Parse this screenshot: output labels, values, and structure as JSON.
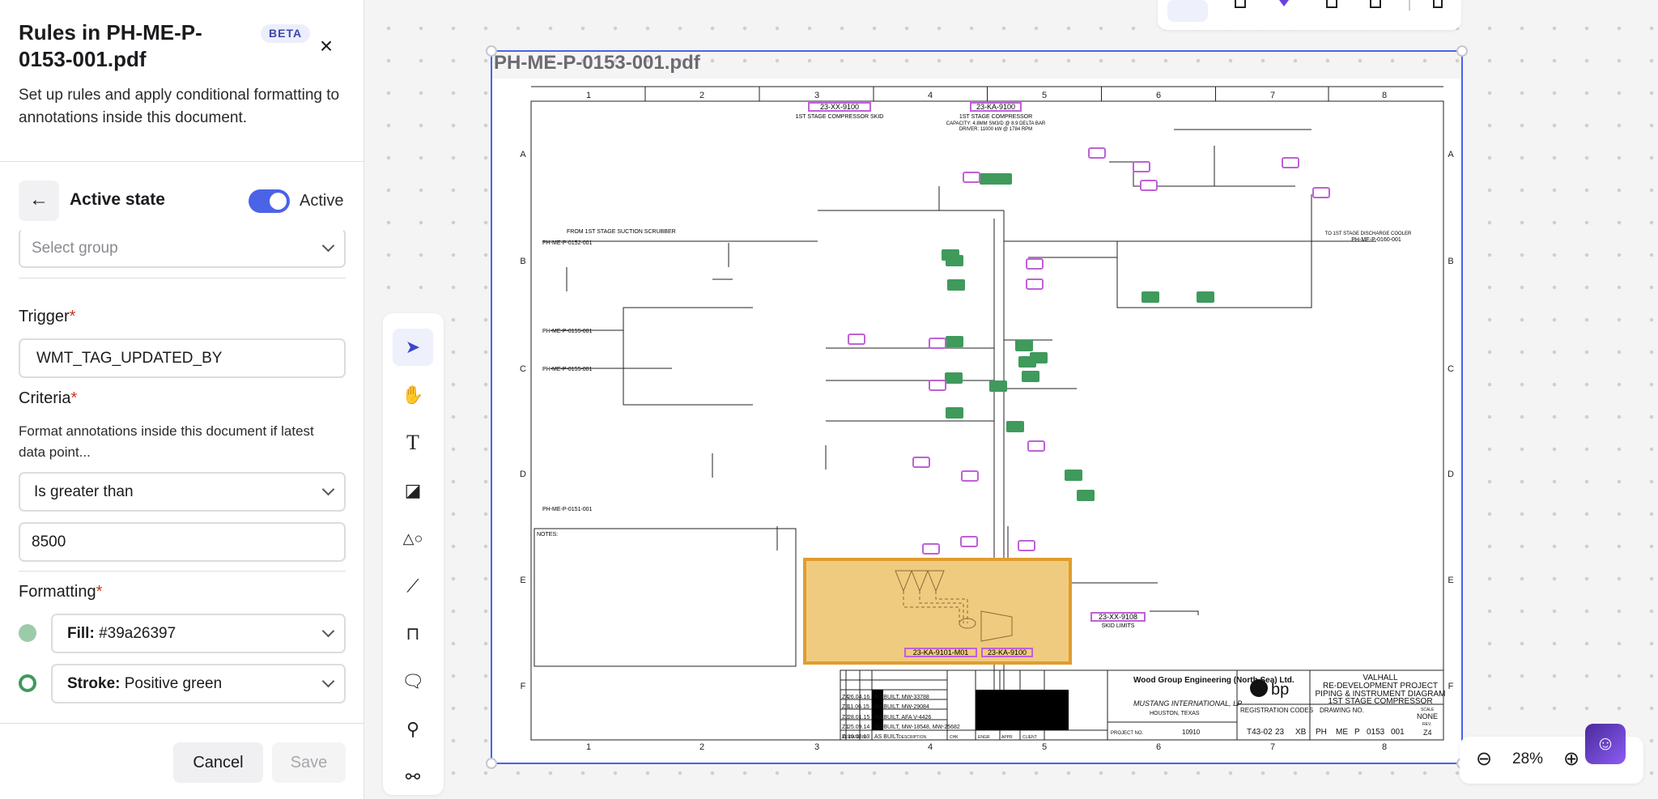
{
  "panel": {
    "title": "Rules in PH-ME-P-0153-001.pdf",
    "badge": "BETA",
    "close_icon": "close-icon",
    "description": "Set up rules and apply conditional formatting to annotations inside this document.",
    "section_title": "Active state",
    "active_toggle": {
      "label": "Active",
      "on": true
    },
    "group_select": {
      "placeholder": "Select group"
    },
    "trigger": {
      "label": "Trigger",
      "required": "*",
      "value": "WMT_TAG_UPDATED_BY"
    },
    "criteria": {
      "label": "Criteria",
      "required": "*",
      "description": "Format annotations inside this document if latest data point...",
      "operator": "Is greater than",
      "value": "8500"
    },
    "formatting": {
      "label": "Formatting",
      "required": "*",
      "fill": {
        "key": "Fill:",
        "value": "#39a26397",
        "color": "#9ccbaa"
      },
      "stroke": {
        "key": "Stroke:",
        "value": "Positive green",
        "color": "#3f9a5c"
      }
    },
    "cancel_label": "Cancel",
    "save_label": "Save"
  },
  "tools": [
    "select-icon",
    "hand-icon",
    "text-icon",
    "sticky-note-icon",
    "shapes-icon",
    "line-icon",
    "polyline-icon",
    "comment-icon",
    "stamp-icon",
    "connections-icon"
  ],
  "document": {
    "filename": "PH-ME-P-0153-001.pdf",
    "columns": [
      "1",
      "2",
      "3",
      "4",
      "5",
      "6",
      "7",
      "8"
    ],
    "rows": [
      "A",
      "B",
      "C",
      "D",
      "E",
      "F"
    ],
    "tags": {
      "skid": "23-XX-9100",
      "skid_caption": "1ST STAGE COMPRESSOR SKID",
      "compressor": "23-KA-9100",
      "compressor_caption": "1ST STAGE COMPRESSOR",
      "capacity": "CAPACITY: 4.8MM SM3/D @ 8.9 DELTA BAR",
      "driver": "DRIVER: 11000 kW @ 1784 RPM",
      "motor": "23-KA-9101-M01",
      "compressor_bottom": "23-KA-9100",
      "skid_limits_tag": "23-XX-9108",
      "skid_limits": "SKID LIMITS",
      "from_scrubber": "FROM 1ST STAGE SUCTION SCRUBBER",
      "ref1": "PH-ME-P-0152-001",
      "ref2": "PH-ME-P-0155-001",
      "ref3": "PH-ME-P-0155-001",
      "ref4": "PH-ME-P-0151-001",
      "ref5": "PH-ME-P-0160-001",
      "to_cooler": "TO 1ST STAGE DISCHARGE COOLER",
      "notes": "NOTES:"
    },
    "revisions": [
      {
        "rev": "Z4",
        "date": "26.04.16",
        "desc": "AS BUILT, MW-33788"
      },
      {
        "rev": "Z3",
        "date": "11.06.15",
        "desc": "AS BUILT, MW-29084"
      },
      {
        "rev": "Z2",
        "date": "28.01.15",
        "desc": "AS BUILT, AFA V-4426"
      },
      {
        "rev": "Z1",
        "date": "25.09.14",
        "desc": "AS BUILT, MW-18548, MW-25682"
      },
      {
        "rev": "Z",
        "date": "16.08.13",
        "desc": "AS BUILT"
      }
    ],
    "rev_headers": [
      "REV",
      "DATE",
      "BY",
      "DESCRIPTION",
      "CHK",
      "ENGR",
      "APPR",
      "CLIENT"
    ],
    "company1": "Wood Group Engineering (North Sea) Ltd.",
    "company2": "MUSTANG INTERNATIONAL, LP",
    "company2_city": "HOUSTON, TEXAS",
    "project_no_label": "PROJECT NO.",
    "project_no": "10910",
    "bp": "bp",
    "project_title": [
      "VALHALL",
      "RE-DEVELOPMENT PROJECT",
      "PIPING & INSTRUMENT DIAGRAM",
      "1ST STAGE COMPRESSOR"
    ],
    "registration_codes": "REGISTRATION CODES",
    "drawing_no_label": "DRAWING NO.",
    "scale_label": "SCALE",
    "scale": "NONE",
    "rev_label": "REV.",
    "rev": "Z4",
    "codes": {
      "area": "T43-02",
      "system": "23",
      "type": "XB",
      "facility": "PH",
      "orig": "ME",
      "disp": "P",
      "seq": "0153",
      "sheet": "001"
    },
    "highlight_color": "#e8a534",
    "tag_color": "#c060d8",
    "live_tag_color": "#3f9a5c"
  },
  "zoom": {
    "level": "28%"
  },
  "colors": {
    "accent": "#4a63e7",
    "selection": "#4a63e7"
  }
}
